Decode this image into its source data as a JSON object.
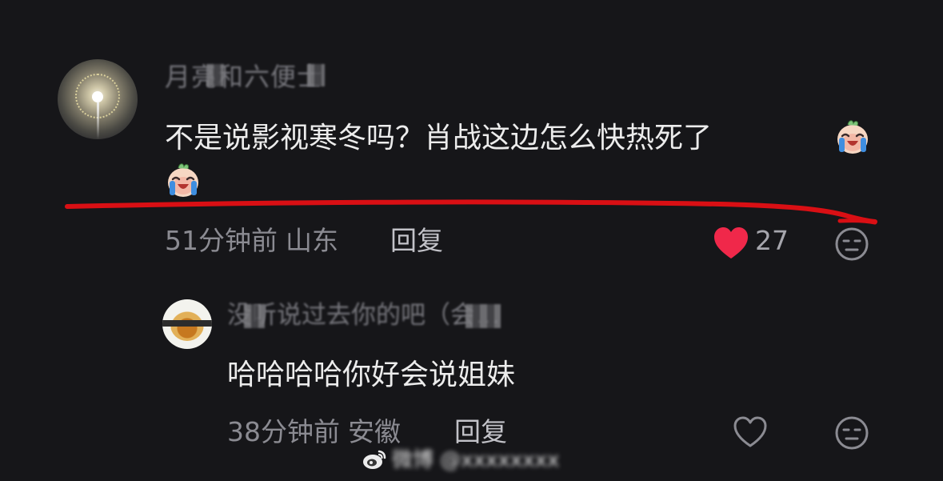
{
  "main_comment": {
    "username": "月亮和六便士",
    "text_line1": "不是说影视寒冬吗？肖战这边怎么快热死了",
    "emoji": "crying-laughing-face",
    "time": "51分钟前",
    "location": "山东",
    "reply_label": "回复",
    "like_count": "27",
    "liked": true
  },
  "reply": {
    "username": "没听说过去你的吧（会…",
    "text": "哈哈哈哈你好会说姐妹",
    "time": "38分钟前",
    "location": "安徽",
    "reply_label": "回复",
    "liked": false
  },
  "watermark": {
    "icon": "weibo-logo-icon",
    "text": "微博 @xxxxxxxx"
  },
  "colors": {
    "background": "#161619",
    "text_primary": "#ececec",
    "text_secondary": "#8b8b92",
    "like_active": "#f0284a",
    "annotation_line": "#d90f14"
  }
}
